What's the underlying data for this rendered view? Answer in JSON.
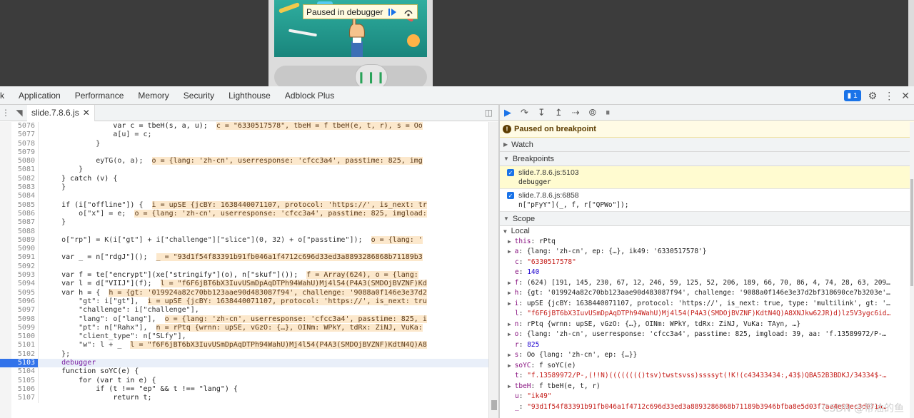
{
  "page": {
    "width": 1280,
    "height": 586
  },
  "viewport": {
    "pause_banner": {
      "label": "Paused in debugger",
      "resume_icon": "resume-icon",
      "step_icon": "step-over-icon"
    },
    "slider_knob_icon": "drag-handle-icon"
  },
  "devtools": {
    "tabs": [
      {
        "label": "k"
      },
      {
        "label": "Application"
      },
      {
        "label": "Performance"
      },
      {
        "label": "Memory"
      },
      {
        "label": "Security"
      },
      {
        "label": "Lighthouse"
      },
      {
        "label": "Adblock Plus"
      }
    ],
    "issues_count": "1"
  },
  "sources": {
    "file_tab": "slide.7.8.6.js",
    "lines": [
      {
        "n": "5076",
        "code": "                var c = tbeH(s, a, u);",
        "inline": "c = \"6330517578\", tbeH = f tbeH(e, t, r), s = Oo"
      },
      {
        "n": "5077",
        "code": "                a[u] = c;",
        "inline": ""
      },
      {
        "n": "5078",
        "code": "            }",
        "inline": ""
      },
      {
        "n": "5079",
        "code": "",
        "inline": ""
      },
      {
        "n": "5080",
        "code": "            eyTG(o, a);",
        "inline": "o = {lang: 'zh-cn', userresponse: 'cfcc3a4', passtime: 825, img"
      },
      {
        "n": "5081",
        "code": "        }",
        "inline": ""
      },
      {
        "n": "5082",
        "code": "    } catch (v) {",
        "inline": ""
      },
      {
        "n": "5083",
        "code": "    }",
        "inline": ""
      },
      {
        "n": "5084",
        "code": "",
        "inline": ""
      },
      {
        "n": "5085",
        "code": "    if (i[\"offline\"]) {",
        "inline": "i = upSE {jcBY: 1638440071107, protocol: 'https://', is_next: tr"
      },
      {
        "n": "5086",
        "code": "        o[\"x\"] = e;",
        "inline": "o = {lang: 'zh-cn', userresponse: 'cfcc3a4', passtime: 825, imgload:"
      },
      {
        "n": "5087",
        "code": "    }",
        "inline": ""
      },
      {
        "n": "5088",
        "code": "",
        "inline": ""
      },
      {
        "n": "5089",
        "code": "    o[\"rp\"] = K(i[\"gt\"] + i[\"challenge\"][\"slice\"](0, 32) + o[\"passtime\"]);",
        "inline": "o = {lang: '"
      },
      {
        "n": "5090",
        "code": "",
        "inline": ""
      },
      {
        "n": "5091",
        "code": "    var _ = n[\"rdgJ\"]();",
        "inline": "_ = \"93d1f54f83391b91fb046a1f4712c696d33ed3a8893286868b71189b3"
      },
      {
        "n": "5092",
        "code": "",
        "inline": ""
      },
      {
        "n": "5093",
        "code": "    var f = te[\"encrypt\"](xe[\"stringify\"](o), n[\"skuf\"]());",
        "inline": "f = Array(624), o = {lang:"
      },
      {
        "n": "5094",
        "code": "    var l = d[\"VIIJ\"](f);",
        "inline": "l = \"f6F6jBT6bX3IuvUSmDpAqDTPh94WahU)Mj4l54(P4A3(SMDOjBVZNF)Kd"
      },
      {
        "n": "5095",
        "code": "    var h = {",
        "inline": "h = {gt: '019924a82c70bb123aae90d483087f94', challenge: '9088a0f146e3e37d2"
      },
      {
        "n": "5096",
        "code": "        \"gt\": i[\"gt\"],",
        "inline": "i = upSE {jcBY: 1638440071107, protocol: 'https://', is_next: tru"
      },
      {
        "n": "5097",
        "code": "        \"challenge\": i[\"challenge\"],",
        "inline": ""
      },
      {
        "n": "5098",
        "code": "        \"lang\": o[\"lang\"],",
        "inline": "o = {lang: 'zh-cn', userresponse: 'cfcc3a4', passtime: 825, i"
      },
      {
        "n": "5099",
        "code": "        \"pt\": n[\"Rahx\"],",
        "inline": "n = rPtq {wrnn: upSE, vGzO: {…}, OINm: WPkY, tdRx: ZiNJ, VuKa:"
      },
      {
        "n": "5100",
        "code": "        \"client_type\": n[\"SLfy\"],",
        "inline": ""
      },
      {
        "n": "5101",
        "code": "        \"w\": l + _",
        "inline": "l = \"f6F6jBT6bX3IuvUSmDpAqDTPh94WahU)Mj4l54(P4A3(SMDOjBVZNF)KdtN4Q)A8"
      },
      {
        "n": "5102",
        "code": "    };",
        "inline": ""
      },
      {
        "n": "5103",
        "code": "    debugger",
        "inline": "",
        "active": true
      },
      {
        "n": "5104",
        "code": "    function soYC(e) {",
        "inline": ""
      },
      {
        "n": "5105",
        "code": "        for (var t in e) {",
        "inline": ""
      },
      {
        "n": "5106",
        "code": "            if (t !== \"ep\" && t !== \"lang\") {",
        "inline": ""
      },
      {
        "n": "5107",
        "code": "                return t;",
        "inline": ""
      }
    ]
  },
  "debugger": {
    "paused_label": "Paused on breakpoint",
    "sections": {
      "watch": "Watch",
      "breakpoints": "Breakpoints",
      "scope": "Scope"
    },
    "breakpoints": [
      {
        "location": "slide.7.8.6.js:5103",
        "code": "debugger"
      },
      {
        "location": "slide.7.8.6.js:6858",
        "code": "n[\"pFyY\"](_, f, r[\"QPWo\"]);"
      }
    ],
    "scope_local": "Local",
    "scope": [
      {
        "exp": "▶",
        "k": "this",
        "v": "rPtq"
      },
      {
        "exp": "▶",
        "k": "a",
        "v": "{lang: 'zh-cn', ep: {…}, ik49: '6330517578'}"
      },
      {
        "exp": "",
        "k": "c",
        "v": "\"6330517578\""
      },
      {
        "exp": "",
        "k": "e",
        "v": "140"
      },
      {
        "exp": "▶",
        "k": "f",
        "v": "(624) [191, 145, 230, 67, 12, 246, 59, 125, 52, 206, 189, 66, 70, 86, 4, 74, 28, 63, 209…"
      },
      {
        "exp": "▶",
        "k": "h",
        "v": "{gt: '019924a82c70bb123aae90d483087f94', challenge: '9088a0f146e3e37d2bf318690ce7b3203e'…"
      },
      {
        "exp": "▶",
        "k": "i",
        "v": "upSE {jcBY: 1638440071107, protocol: 'https://', is_next: true, type: 'multilink', gt: '…"
      },
      {
        "exp": "",
        "k": "l",
        "v": "\"f6F6jBT6bX3IuvUSmDpAqDTPh94WahU)Mj4l54(P4A3(SMDOjBVZNF)KdtN4Q)A8XNJkw62JR)d)lz5V3ygc6id…"
      },
      {
        "exp": "▶",
        "k": "n",
        "v": "rPtq {wrnn: upSE, vGzO: {…}, OINm: WPkY, tdRx: ZiNJ, VuKa: TAyn, …}"
      },
      {
        "exp": "▶",
        "k": "o",
        "v": "{lang: 'zh-cn', userresponse: 'cfcc3a4', passtime: 825, imgload: 39, aa: 'f.13589972/P-…"
      },
      {
        "exp": "",
        "k": "r",
        "v": "825"
      },
      {
        "exp": "▶",
        "k": "s",
        "v": "Oo {lang: 'zh-cn', ep: {…}}"
      },
      {
        "exp": "▶",
        "k": "soYC",
        "v": "f soYC(e)"
      },
      {
        "exp": "",
        "k": "t",
        "v": "\"f.13589972/P-,(!!N)(((((((()tsv)twstsvss)ssssyt(!K!(c43433434:,43$)QBA52B3BDKJ/34334$-…"
      },
      {
        "exp": "▶",
        "k": "tbeH",
        "v": "f tbeH(e, t, r)"
      },
      {
        "exp": "",
        "k": "u",
        "v": "\"ik49\""
      },
      {
        "exp": "",
        "k": "_",
        "v": "\"93d1f54f83391b91fb046a1f4712c696d33ed3a8893286868b71189b3946bfba8e5d03f7ae4e03ec3d071a…"
      }
    ]
  },
  "watermark": "CSDN @带油的鱼"
}
